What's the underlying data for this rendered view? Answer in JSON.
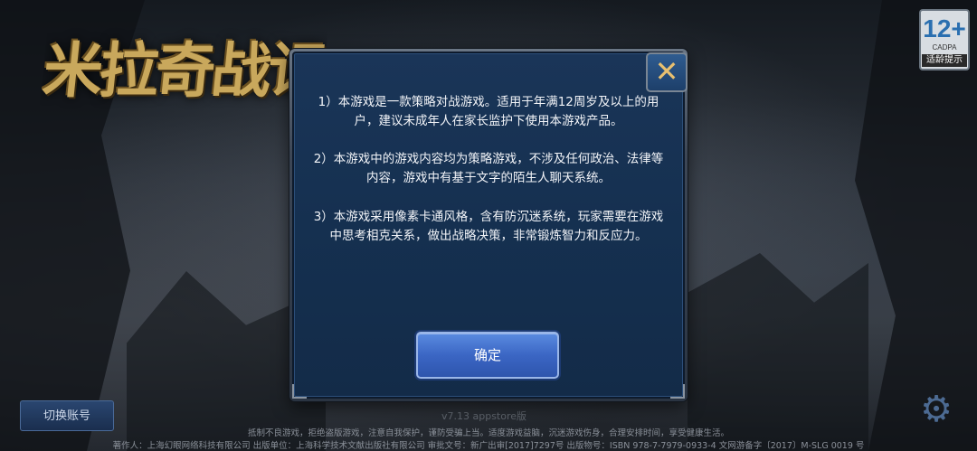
{
  "game": {
    "logo_text": "米拉奇战记"
  },
  "age_rating": {
    "label": "12+",
    "org": "CADPA",
    "hint": "适龄提示"
  },
  "dialog": {
    "paragraphs": [
      "1）本游戏是一款策略对战游戏。适用于年满12周岁及以上的用户，建议未成年人在家长监护下使用本游戏产品。",
      "2）本游戏中的游戏内容均为策略游戏，不涉及任何政治、法律等内容，游戏中有基于文字的陌生人聊天系统。",
      "3）本游戏采用像素卡通风格，含有防沉迷系统，玩家需要在游戏中思考相克关系，做出战略决策，非常锻炼智力和反应力。"
    ],
    "confirm_label": "确定",
    "close_symbol": "✕"
  },
  "controls": {
    "switch_account_label": "切换账号",
    "settings_icon": "gear-icon"
  },
  "footer": {
    "ghost_text": "v7.13 appstore版",
    "line1": "抵制不良游戏，拒绝盗版游戏，注意自我保护，谨防受骗上当。适度游戏益脑，沉迷游戏伤身，合理安排时间，享受健康生活。",
    "line2": "著作人：上海幻眼网络科技有限公司 出版单位：上海科学技术文献出版社有限公司 审批文号：新广出审[2017]7297号 出版物号：ISBN 978-7-7979-0933-4 文网游备字〔2017〕M-SLG 0019 号"
  },
  "colors": {
    "accent": "#3b66c4",
    "close_x": "#e8c070",
    "panel": "#153050"
  }
}
